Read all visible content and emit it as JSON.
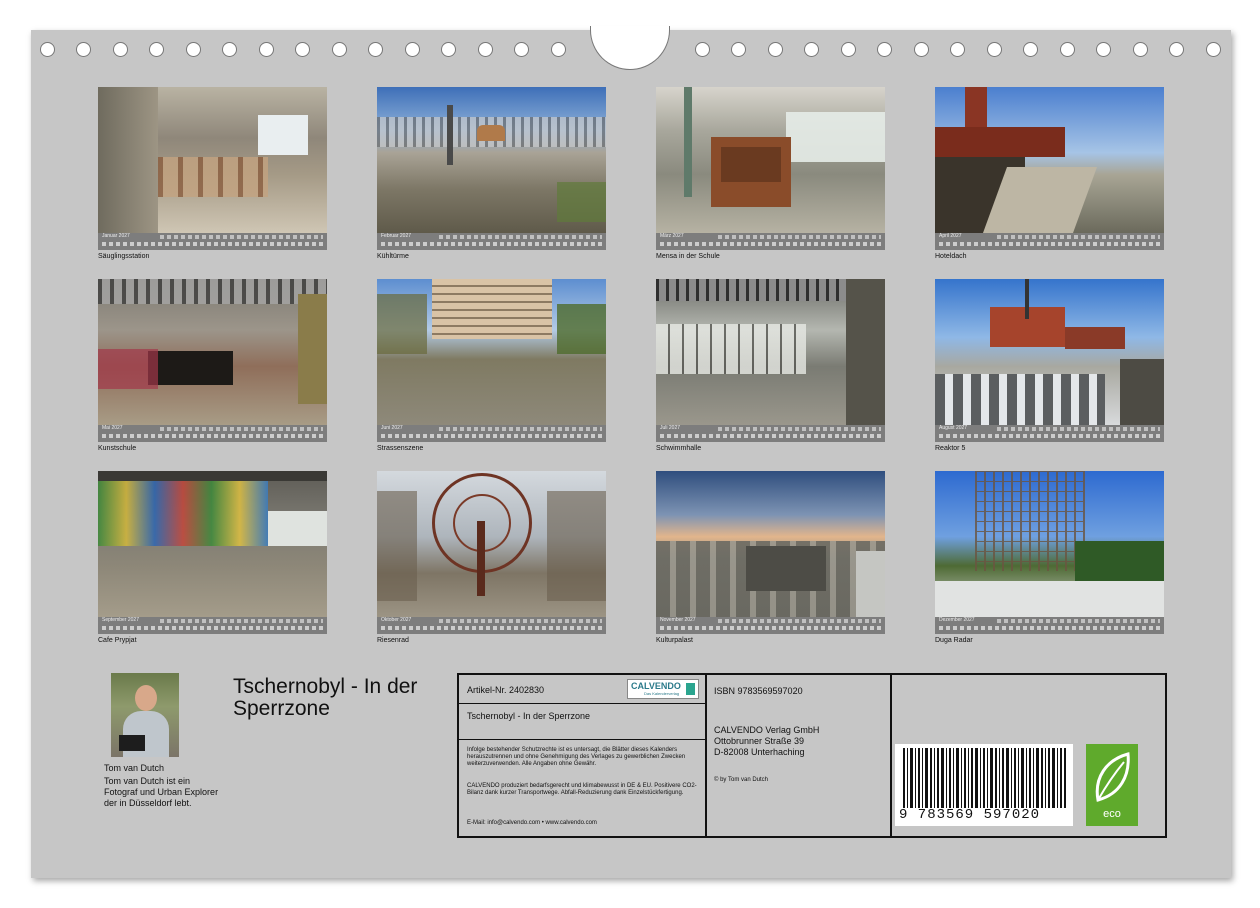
{
  "months": [
    {
      "label": "Januar 2027",
      "caption": "Säuglingsstation"
    },
    {
      "label": "Februar 2027",
      "caption": "Kühltürme"
    },
    {
      "label": "März 2027",
      "caption": "Mensa in der Schule"
    },
    {
      "label": "April 2027",
      "caption": "Hoteldach"
    },
    {
      "label": "Mai 2027",
      "caption": "Kunstschule"
    },
    {
      "label": "Juni 2027",
      "caption": "Strassenszene"
    },
    {
      "label": "Juli 2027",
      "caption": "Schwimmhalle"
    },
    {
      "label": "August 2027",
      "caption": "Reaktor 5"
    },
    {
      "label": "September 2027",
      "caption": "Cafe Prypjat"
    },
    {
      "label": "Oktober 2027",
      "caption": "Riesenrad"
    },
    {
      "label": "November 2027",
      "caption": "Kulturpalast"
    },
    {
      "label": "Dezember 2027",
      "caption": "Duga Radar"
    }
  ],
  "author": {
    "name": "Tom van Dutch",
    "bio": "Tom van Dutch ist ein Fotograf und Urban Explorer der in Düsseldorf lebt."
  },
  "title": "Tschernobyl - In der Sperrzone",
  "info": {
    "article": "Artikel-Nr. 2402830",
    "logo_text": "CALVENDO",
    "logo_sub": "Das Kalenderverlag",
    "product_title": "Tschernobyl - In der Sperrzone",
    "legal": "Infolge bestehender Schutzrechte ist es untersagt, die Blätter dieses Kalenders herauszutrennen und ohne Genehmigung des Verlages zu gewerblichen Zwecken weiterzuverwenden. Alle Angaben ohne Gewähr.",
    "eco_text": "CALVENDO produziert bedarfsgerecht und klimabewusst in DE & EU. Positivere CO2-Bilanz dank kurzer Transportwege. Abfall-Reduzierung dank Einzelstückfertigung.",
    "contact": "E-Mail: info@calvendo.com • www.calvendo.com",
    "isbn": "ISBN 9783569597020",
    "publisher": [
      "CALVENDO Verlag GmbH",
      "Ottobrunner Straße 39",
      "D-82008 Unterhaching"
    ],
    "copyright": "© by Tom van Dutch",
    "barcode_number": "9 783569 597020",
    "eco_label": "eco"
  }
}
